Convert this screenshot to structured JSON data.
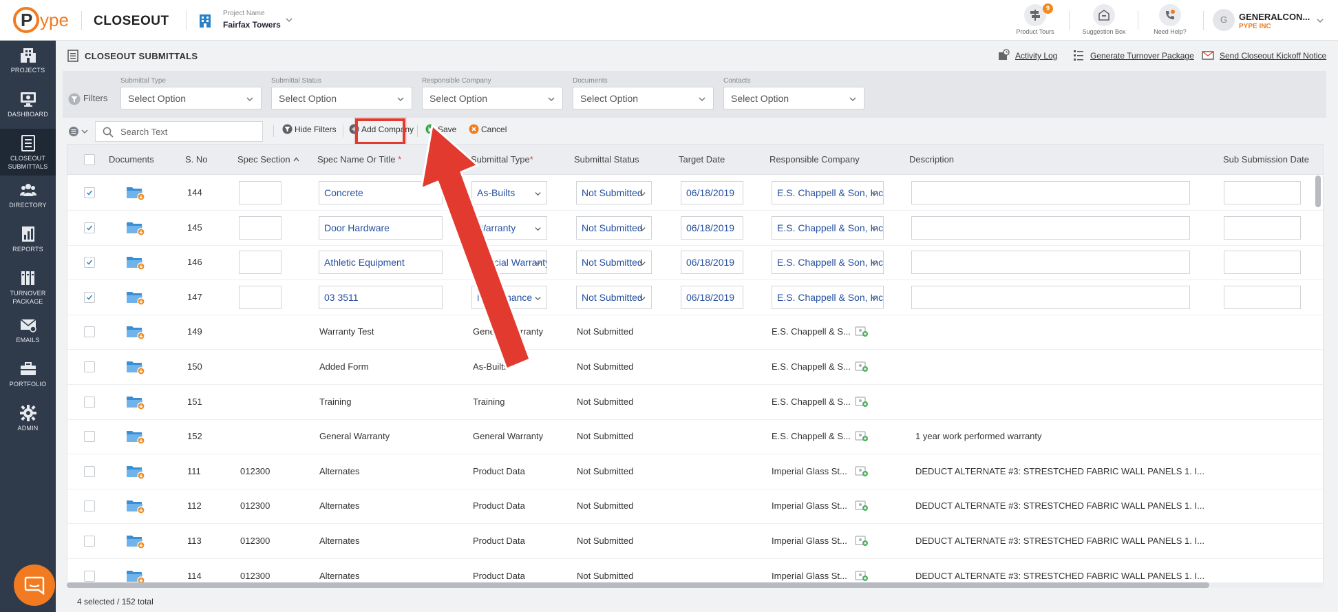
{
  "header": {
    "logo_text": "ype",
    "app_title": "CLOSEOUT",
    "project_caption": "Project Name",
    "project_name": "Fairfax Towers",
    "tools": [
      {
        "label": "Product Tours",
        "icon": "signpost-icon",
        "badge": "9"
      },
      {
        "label": "Suggestion Box",
        "icon": "suggestion-box-icon"
      },
      {
        "label": "Need Help?",
        "icon": "help-phone-icon"
      }
    ],
    "user_initial": "G",
    "user_name": "GENERALCON...",
    "user_company": "PYPE INC"
  },
  "sidebar": {
    "items": [
      {
        "label": "PROJECTS",
        "icon": "building-icon",
        "active": false
      },
      {
        "label": "DASHBOARD",
        "icon": "monitor-icon",
        "active": false
      },
      {
        "label": "CLOSEOUT SUBMITTALS",
        "line1": "CLOSEOUT",
        "line2": "SUBMITTALS",
        "icon": "clipboard-list-icon",
        "active": true
      },
      {
        "label": "DIRECTORY",
        "icon": "people-icon",
        "active": false
      },
      {
        "label": "REPORTS",
        "icon": "report-chart-icon",
        "active": false
      },
      {
        "label": "TURNOVER PACKAGE",
        "line1": "TURNOVER",
        "line2": "PACKAGE",
        "icon": "binders-icon",
        "active": false
      },
      {
        "label": "EMAILS",
        "icon": "envelope-icon",
        "active": false
      },
      {
        "label": "PORTFOLIO",
        "icon": "briefcase-icon",
        "active": false
      },
      {
        "label": "ADMIN",
        "icon": "gear-icon",
        "active": false
      }
    ]
  },
  "page": {
    "title": "CLOSEOUT SUBMITTALS",
    "links": {
      "activity_log": "Activity Log",
      "turnover": "Generate Turnover Package",
      "kickoff": "Send Closeout Kickoff Notice"
    }
  },
  "filters": {
    "label": "Filters",
    "items": [
      {
        "label": "Submittal Type",
        "value": "Select Option"
      },
      {
        "label": "Submittal Status",
        "value": "Select Option"
      },
      {
        "label": "Responsible Company",
        "value": "Select Option"
      },
      {
        "label": "Documents",
        "value": "Select Option"
      },
      {
        "label": "Contacts",
        "value": "Select Option"
      }
    ]
  },
  "toolbar": {
    "search_placeholder": "Search Text",
    "hide_filters": "Hide Filters",
    "add_company": "Add Company",
    "save": "Save",
    "cancel": "Cancel"
  },
  "grid": {
    "columns": {
      "documents": "Documents",
      "sno": "S. No",
      "spec_section": "Spec Section",
      "spec_name": "Spec Name Or Title",
      "submittal_type": "Submittal Type",
      "submittal_status": "Submittal Status",
      "target_date": "Target Date",
      "responsible_company": "Responsible Company",
      "description": "Description",
      "sub_submission_date": "Sub Submission Date"
    },
    "required_mark": "*",
    "rows": [
      {
        "checked": true,
        "editing": true,
        "sno": "144",
        "spec_section": "",
        "spec_name": "Concrete",
        "submittal_type": "As-Builts",
        "status": "Not Submitted",
        "target_date": "06/18/2019",
        "company": "E.S. Chappell & Son, Inc.",
        "description": ""
      },
      {
        "checked": true,
        "editing": true,
        "sno": "145",
        "spec_section": "",
        "spec_name": "Door Hardware",
        "submittal_type": "Warranty",
        "status": "Not Submitted",
        "target_date": "06/18/2019",
        "company": "E.S. Chappell & Son, Inc.",
        "description": ""
      },
      {
        "checked": true,
        "editing": true,
        "sno": "146",
        "spec_section": "",
        "spec_name": "Athletic Equipment",
        "submittal_type": "Special Warranty",
        "status": "Not Submitted",
        "target_date": "06/18/2019",
        "company": "E.S. Chappell & Son, Inc.",
        "description": ""
      },
      {
        "checked": true,
        "editing": true,
        "sno": "147",
        "spec_section": "",
        "spec_name": "03 3511",
        "submittal_type": "Maintenance",
        "status": "Not Submitted",
        "target_date": "06/18/2019",
        "company": "E.S. Chappell & Son, Inc.",
        "description": ""
      },
      {
        "checked": false,
        "editing": false,
        "sno": "149",
        "spec_section": "",
        "spec_name": "Warranty Test",
        "submittal_type": "General Warranty",
        "status": "Not Submitted",
        "target_date": "",
        "company": "E.S. Chappell & S...",
        "description": ""
      },
      {
        "checked": false,
        "editing": false,
        "sno": "150",
        "spec_section": "",
        "spec_name": "Added Form",
        "submittal_type": "As-Builts",
        "status": "Not Submitted",
        "target_date": "",
        "company": "E.S. Chappell & S...",
        "description": ""
      },
      {
        "checked": false,
        "editing": false,
        "sno": "151",
        "spec_section": "",
        "spec_name": "Training",
        "submittal_type": "Training",
        "status": "Not Submitted",
        "target_date": "",
        "company": "E.S. Chappell & S...",
        "description": ""
      },
      {
        "checked": false,
        "editing": false,
        "sno": "152",
        "spec_section": "",
        "spec_name": "General Warranty",
        "submittal_type": "General Warranty",
        "status": "Not Submitted",
        "target_date": "",
        "company": "E.S. Chappell & S...",
        "description": "1 year work performed warranty"
      },
      {
        "checked": false,
        "editing": false,
        "sno": "111",
        "spec_section": "012300",
        "spec_name": "Alternates",
        "submittal_type": "Product Data",
        "status": "Not Submitted",
        "target_date": "",
        "company": "Imperial Glass St...",
        "description": "DEDUCT ALTERNATE #3: STRESTCHED FABRIC WALL PANELS 1. I..."
      },
      {
        "checked": false,
        "editing": false,
        "sno": "112",
        "spec_section": "012300",
        "spec_name": "Alternates",
        "submittal_type": "Product Data",
        "status": "Not Submitted",
        "target_date": "",
        "company": "Imperial Glass St...",
        "description": "DEDUCT ALTERNATE #3: STRESTCHED FABRIC WALL PANELS 1. I..."
      },
      {
        "checked": false,
        "editing": false,
        "sno": "113",
        "spec_section": "012300",
        "spec_name": "Alternates",
        "submittal_type": "Product Data",
        "status": "Not Submitted",
        "target_date": "",
        "company": "Imperial Glass St...",
        "description": "DEDUCT ALTERNATE #3: STRESTCHED FABRIC WALL PANELS 1. I..."
      },
      {
        "checked": false,
        "editing": false,
        "sno": "114",
        "spec_section": "012300",
        "spec_name": "Alternates",
        "submittal_type": "Product Data",
        "status": "Not Submitted",
        "target_date": "",
        "company": "Imperial Glass St...",
        "description": "DEDUCT ALTERNATE #3: STRESTCHED FABRIC WALL PANELS 1. I..."
      }
    ]
  },
  "footer": {
    "selection_count": "4 selected / 152 total"
  },
  "colors": {
    "brand_orange": "#f27a21",
    "sidebar_bg": "#2f3a4a",
    "link_blue": "#2450a0",
    "highlight_red": "#e33a2f"
  }
}
